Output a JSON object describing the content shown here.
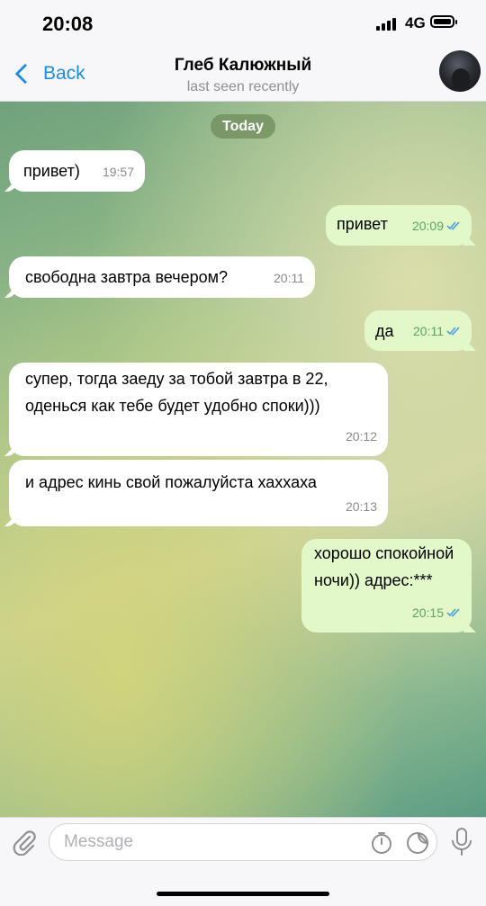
{
  "status": {
    "time": "20:08",
    "network": "4G"
  },
  "header": {
    "back_label": "Back",
    "name": "Глеб Калюжный",
    "status": "last seen recently"
  },
  "chat": {
    "date_label": "Today",
    "messages": [
      {
        "dir": "in",
        "text": "привет)",
        "time": "19:57"
      },
      {
        "dir": "out",
        "text": "привет",
        "time": "20:09",
        "read": true
      },
      {
        "dir": "in",
        "text": "свободна завтра вечером?",
        "time": "20:11"
      },
      {
        "dir": "out",
        "text": "да",
        "time": "20:11",
        "read": true
      },
      {
        "dir": "in",
        "text": "супер, тогда заеду за тобой завтра в 22, оденься как тебе будет удобно споки)))",
        "time": "20:12"
      },
      {
        "dir": "in",
        "text": "и адрес кинь свой пожалуйста хаххаха",
        "time": "20:13"
      },
      {
        "dir": "out",
        "text": "хорошо спокойной ночи)) адрес:***",
        "time": "20:15",
        "read": true
      }
    ]
  },
  "composer": {
    "placeholder": "Message"
  },
  "colors": {
    "accent": "#1a8cf0",
    "outgoing_bubble": "#e2f8c9",
    "incoming_bubble": "#ffffff",
    "read_check": "#4a9fe0"
  }
}
